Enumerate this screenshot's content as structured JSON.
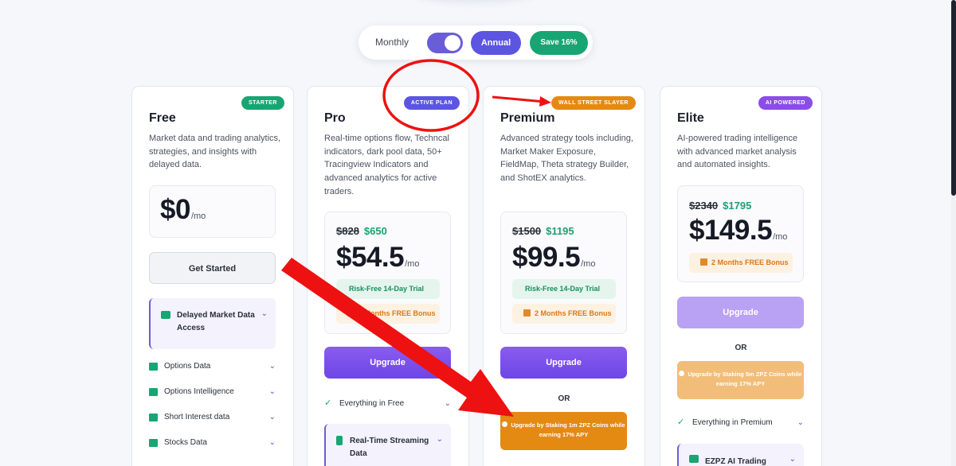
{
  "toggle": {
    "monthly_label": "Monthly",
    "annual_label": "Annual",
    "save_label": "Save 16%"
  },
  "colors": {
    "primary": "#5c55e2",
    "green": "#17a673",
    "orange": "#e48a13",
    "annotation_red": "#ee1111"
  },
  "plans": [
    {
      "badge": "STARTER",
      "title": "Free",
      "description": "Market data and trading analytics, strategies, and insights with delayed data.",
      "price": "$0",
      "per": "/mo",
      "button": "Get Started",
      "featured": {
        "label": "Delayed Market Data Access",
        "icon": "graduation-cap-icon"
      },
      "features": [
        {
          "label": "Options Data",
          "icon": "list-icon"
        },
        {
          "label": "Options Intelligence",
          "icon": "chart-line-icon"
        },
        {
          "label": "Short Interest data",
          "icon": "users-icon"
        },
        {
          "label": "Stocks Data",
          "icon": "database-icon"
        }
      ]
    },
    {
      "badge": "ACTIVE PLAN",
      "title": "Pro",
      "description": "Real-time options flow, Techncal indicators, dark pool data, 50+ Tracingview Indicators and advanced analytics for active traders.",
      "old_price": "$828",
      "new_price": "$650",
      "price": "$54.5",
      "per": "/mo",
      "trial": "Risk-Free 14-Day Trial",
      "bonus": "2 Months FREE Bonus",
      "button": "Upgrade",
      "everything": "Everything in Free",
      "featured": {
        "label": "Real-Time Streaming Data",
        "icon": "lightning-icon"
      }
    },
    {
      "badge": "WALL STREET SLAYER",
      "title": "Premium",
      "description": "Advanced strategy tools including, Market Maker Exposure, FieldMap, Theta strategy Builder, and ShotEX analytics.",
      "old_price": "$1500",
      "new_price": "$1195",
      "price": "$99.5",
      "per": "/mo",
      "trial": "Risk-Free 14-Day Trial",
      "bonus": "2 Months FREE Bonus",
      "button": "Upgrade",
      "or": "OR",
      "stake": "Upgrade by Staking 1m ZPZ Coins while earning 17% APY"
    },
    {
      "badge": "AI POWERED",
      "title": "Elite",
      "description": "AI-powered trading intelligence with advanced market analysis and automated insights.",
      "old_price": "$2340",
      "new_price": "$1795",
      "price": "$149.5",
      "per": "/mo",
      "bonus": "2 Months FREE Bonus",
      "button": "Upgrade",
      "or": "OR",
      "stake": "Upgrade by Staking 5m ZPZ Coins while earning 17% APY",
      "everything": "Everything in Premium",
      "featured": {
        "label": "EZPZ AI Trading",
        "icon": "robot-icon"
      }
    }
  ]
}
